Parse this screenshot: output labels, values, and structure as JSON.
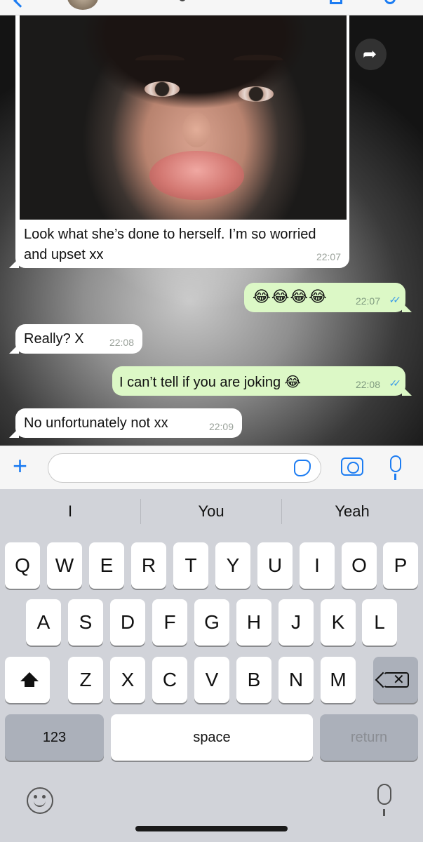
{
  "messages": [
    {
      "id": "m1",
      "direction": "in",
      "type": "image",
      "caption": "Look what she’s done to herself. I’m so worried and upset xx",
      "time": "22:07"
    },
    {
      "id": "m2",
      "direction": "out",
      "text": "😂😂😂😂",
      "time": "22:07",
      "status": "read"
    },
    {
      "id": "m3",
      "direction": "in",
      "text": "Really? X",
      "time": "22:08"
    },
    {
      "id": "m4",
      "direction": "out",
      "text": "I can’t tell if you are joking 😂",
      "time": "22:08",
      "status": "read"
    },
    {
      "id": "m5",
      "direction": "in",
      "text": "No unfortunately not xx",
      "time": "22:09"
    }
  ],
  "icons": {
    "read_ticks": "✓✓",
    "forward": "➦"
  },
  "compose": {
    "plus": "+",
    "placeholder": ""
  },
  "keyboard": {
    "suggestions": [
      "I",
      "You",
      "Yeah"
    ],
    "row1": [
      "Q",
      "W",
      "E",
      "R",
      "T",
      "Y",
      "U",
      "I",
      "O",
      "P"
    ],
    "row2": [
      "A",
      "S",
      "D",
      "F",
      "G",
      "H",
      "J",
      "K",
      "L"
    ],
    "row3": [
      "Z",
      "X",
      "C",
      "V",
      "B",
      "N",
      "M"
    ],
    "numbers_label": "123",
    "space_label": "space",
    "return_label": "return",
    "backspace_glyph": "✕"
  },
  "colors": {
    "accent": "#1c7cf2",
    "outgoing_bubble": "#dcf8c6",
    "incoming_bubble": "#ffffff",
    "read_ticks": "#3a9be8"
  }
}
